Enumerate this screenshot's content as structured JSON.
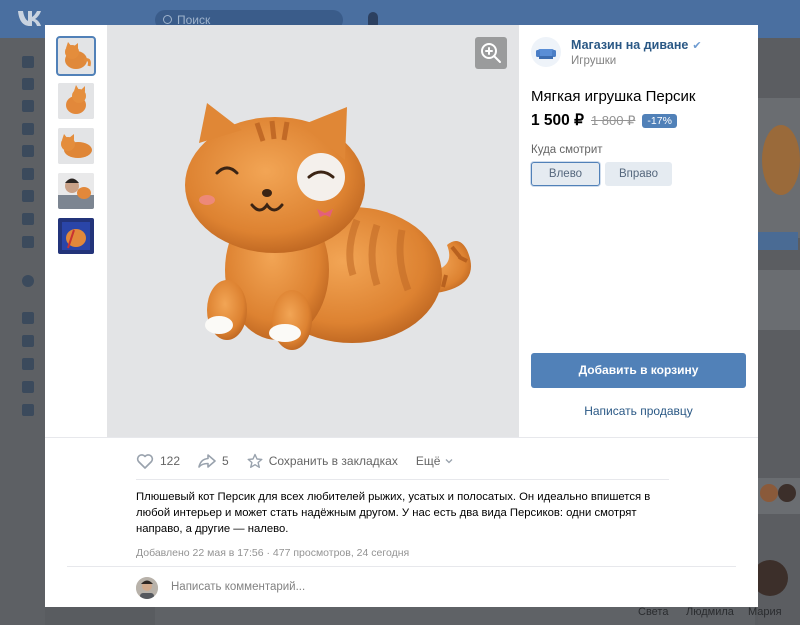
{
  "background": {
    "search_placeholder": "Поиск",
    "friends": [
      "Света",
      "Людмила",
      "Мария"
    ]
  },
  "colors": {
    "accent": "#5181b8",
    "link": "#2a5885",
    "header": "#4a76a8"
  },
  "thumbnails": [
    {
      "icon": "orange-cat-plush",
      "active": true
    },
    {
      "icon": "orange-cat-plush-side"
    },
    {
      "icon": "orange-cat-plush-lying"
    },
    {
      "icon": "person-with-plush"
    },
    {
      "icon": "plush-in-package"
    }
  ],
  "shop": {
    "name": "Магазин на диване",
    "category": "Игрушки",
    "verified_icon": "check-icon"
  },
  "product": {
    "title": "Мягкая игрушка Персик",
    "price": "1 500 ₽",
    "old_price": "1 800 ₽",
    "discount": "-17%",
    "variant_label": "Куда смотрит",
    "variants": [
      {
        "label": "Влево",
        "selected": true
      },
      {
        "label": "Вправо",
        "selected": false
      }
    ],
    "add_to_cart": "Добавить в корзину",
    "write_seller": "Написать продавцу"
  },
  "actions": {
    "likes": "122",
    "shares": "5",
    "bookmark": "Сохранить в закладках",
    "more": "Ещё"
  },
  "description": "Плюшевый кот Персик для всех любителей рыжих, усатых и полосатых. Он идеально впишется в любой интерьер и может стать надёжным другом. У нас есть два вида Персиков: одни смотрят направо, а другие — налево.",
  "meta": "Добавлено 22 мая в 17:56 · 477 просмотров, 24 сегодня",
  "comment_placeholder": "Написать комментарий..."
}
